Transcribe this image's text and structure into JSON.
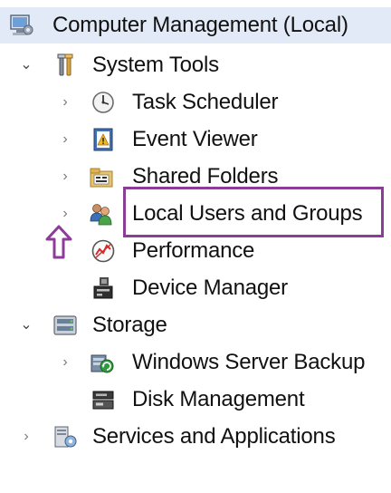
{
  "tree": {
    "root": {
      "label": "Computer Management (Local)",
      "icon": "computer-management-icon"
    },
    "system_tools": {
      "label": "System Tools",
      "icon": "tools-icon",
      "children": [
        {
          "label": "Task Scheduler",
          "icon": "clock-icon"
        },
        {
          "label": "Event Viewer",
          "icon": "event-viewer-icon"
        },
        {
          "label": "Shared Folders",
          "icon": "shared-folder-icon"
        },
        {
          "label": "Local Users and Groups",
          "icon": "users-icon"
        },
        {
          "label": "Performance",
          "icon": "performance-icon"
        },
        {
          "label": "Device Manager",
          "icon": "device-manager-icon"
        }
      ]
    },
    "storage": {
      "label": "Storage",
      "icon": "storage-icon",
      "children": [
        {
          "label": "Windows Server Backup",
          "icon": "backup-icon"
        },
        {
          "label": "Disk Management",
          "icon": "disk-icon"
        }
      ]
    },
    "services": {
      "label": "Services and Applications",
      "icon": "services-icon"
    }
  },
  "annotation": {
    "highlight_color": "#8b3d97"
  }
}
